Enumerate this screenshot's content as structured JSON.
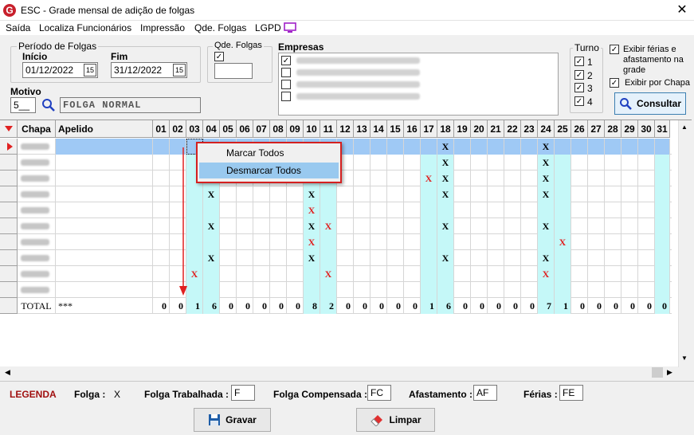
{
  "window": {
    "title": "ESC - Grade mensal de adição de folgas",
    "app_icon_letter": "G"
  },
  "menu": [
    {
      "label": "Saída"
    },
    {
      "label": "Localiza Funcionários"
    },
    {
      "label": "Impressão"
    },
    {
      "label": "Qde. Folgas"
    },
    {
      "label": "LGPD"
    }
  ],
  "periodo": {
    "group_label": "Período de Folgas",
    "inicio_label": "Início",
    "inicio_value": "01/12/2022",
    "fim_label": "Fim",
    "fim_value": "31/12/2022",
    "cal_glyph": "15"
  },
  "qde_folgas": {
    "label": "Qde. Folgas",
    "value": ""
  },
  "empresas": {
    "label": "Empresas"
  },
  "turno": {
    "label": "Turno",
    "items": [
      "1",
      "2",
      "3",
      "4"
    ]
  },
  "options": {
    "exibir_ferias": "Exibir férias e afastamento na grade",
    "exibir_chapa": "Exibir por Chapa"
  },
  "consultar_label": "Consultar",
  "motivo": {
    "label": "Motivo",
    "code": "5__",
    "desc": "FOLGA NORMAL"
  },
  "grid": {
    "headers": {
      "chapa": "Chapa",
      "apelido": "Apelido"
    },
    "days": [
      "01",
      "02",
      "03",
      "04",
      "05",
      "06",
      "07",
      "08",
      "09",
      "10",
      "11",
      "12",
      "13",
      "14",
      "15",
      "16",
      "17",
      "18",
      "19",
      "20",
      "21",
      "22",
      "23",
      "24",
      "25",
      "26",
      "27",
      "28",
      "29",
      "30",
      "31"
    ],
    "rows": [
      {
        "marks": {
          "18": "X",
          "24": "X"
        }
      },
      {
        "marks": {
          "18": "X",
          "24": "X"
        }
      },
      {
        "marks": {
          "17": "XR",
          "18": "X",
          "24": "X"
        }
      },
      {
        "marks": {
          "04": "X",
          "10": "X",
          "18": "X",
          "24": "X"
        }
      },
      {
        "marks": {
          "10": "XR"
        }
      },
      {
        "marks": {
          "04": "X",
          "10": "X",
          "11": "XR",
          "18": "X",
          "24": "X"
        }
      },
      {
        "marks": {
          "10": "XR",
          "25": "XR"
        }
      },
      {
        "marks": {
          "04": "X",
          "10": "X",
          "18": "X",
          "24": "X"
        }
      },
      {
        "marks": {
          "03": "XR",
          "11": "XR",
          "24": "XR"
        }
      },
      {
        "marks": {}
      }
    ],
    "total": {
      "label": "TOTAL",
      "apelido": "***",
      "values": [
        "0",
        "0",
        "1",
        "6",
        "0",
        "0",
        "0",
        "0",
        "0",
        "8",
        "2",
        "0",
        "0",
        "0",
        "0",
        "0",
        "1",
        "6",
        "0",
        "0",
        "0",
        "0",
        "0",
        "7",
        "1",
        "0",
        "0",
        "0",
        "0",
        "0",
        "0"
      ]
    }
  },
  "context_menu": {
    "items": [
      "Marcar Todos",
      "Desmarcar Todos"
    ]
  },
  "legend": {
    "title": "LEGENDA",
    "folga_label": "Folga :",
    "folga_value": "X",
    "trabalhada_label": "Folga Trabalhada :",
    "trabalhada_value": "F",
    "compensada_label": "Folga Compensada :",
    "compensada_value": "FC",
    "afastamento_label": "Afastamento :",
    "afastamento_value": "AF",
    "ferias_label": "Férias :",
    "ferias_value": "FE"
  },
  "buttons": {
    "gravar": "Gravar",
    "limpar": "Limpar"
  },
  "colors": {
    "cyan_column": "#c5f8f8",
    "selected_row": "#9fc9f5",
    "red_mark": "#e02020",
    "context_border": "#d42020"
  }
}
